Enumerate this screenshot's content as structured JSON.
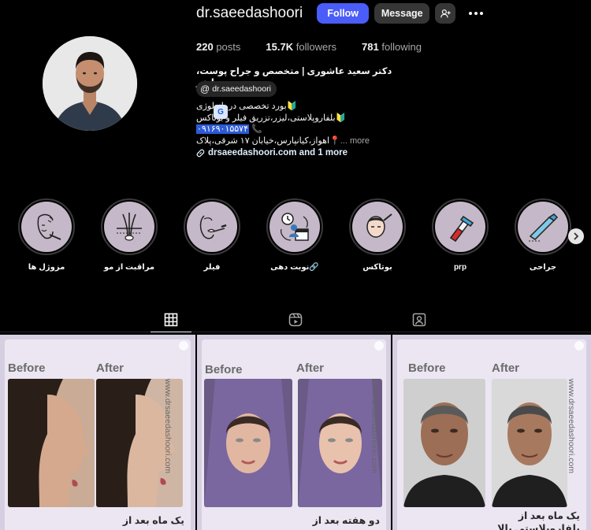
{
  "profile": {
    "username": "dr.saeedashoori",
    "follow_label": "Follow",
    "message_label": "Message",
    "stats": {
      "posts_value": "220",
      "posts_label": "posts",
      "followers_value": "15.7K",
      "followers_label": "followers",
      "following_value": "781",
      "following_label": "following"
    },
    "full_name": "دکتر سعید عاشوری | متخصص و جراح پوست، مو، لیزر",
    "threads_handle": "dr.saeedashoori",
    "bio": {
      "line1": "🔰بورد تخصصی درماتولوژی",
      "line2": "🔰بلفاروپلاستی،لیزر،تزریق فیلر و بوتاکس",
      "phone": "۰۹۱۶۹۰۱۵۵۷۴",
      "line4": "📍اهواز،کیانپارس،خیابان ۱۷ شرقی،پلاک",
      "more_label": "... more",
      "link": "drsaeedashoori.com and 1 more"
    }
  },
  "highlights": [
    {
      "label": "جراحی",
      "icon": "scalpel-icon"
    },
    {
      "label": "prp",
      "icon": "test-tube-icon"
    },
    {
      "label": "بوتاکس",
      "icon": "face-injection-icon"
    },
    {
      "label": "🔗نوبت دهی",
      "icon": "calendar-clock-icon"
    },
    {
      "label": "فیلر",
      "icon": "lips-filler-icon"
    },
    {
      "label": "مراقبت از مو",
      "icon": "hair-follicle-icon"
    },
    {
      "label": "مزوژل ها",
      "icon": "face-mesogel-icon"
    }
  ],
  "posts": [
    {
      "before": "Before",
      "after": "After",
      "caption": "یک ماه بعد از",
      "caption2": "",
      "url": "www.drsaeedashoori.com"
    },
    {
      "before": "Before",
      "after": "After",
      "caption": "دو هفته بعد از",
      "caption2": "",
      "url": "www.drsaeedashoori.com"
    },
    {
      "before": "Before",
      "after": "After",
      "caption": "یک ماه بعد از",
      "caption2": "بلفاروپلاستی بالا",
      "url": "www.drsaeedashoori.com"
    }
  ],
  "translate_badge": "G",
  "colors": {
    "follow": "#4a5df9",
    "highlight_bg": "#c5b8c8",
    "post_bg": "#ebe6f2"
  }
}
